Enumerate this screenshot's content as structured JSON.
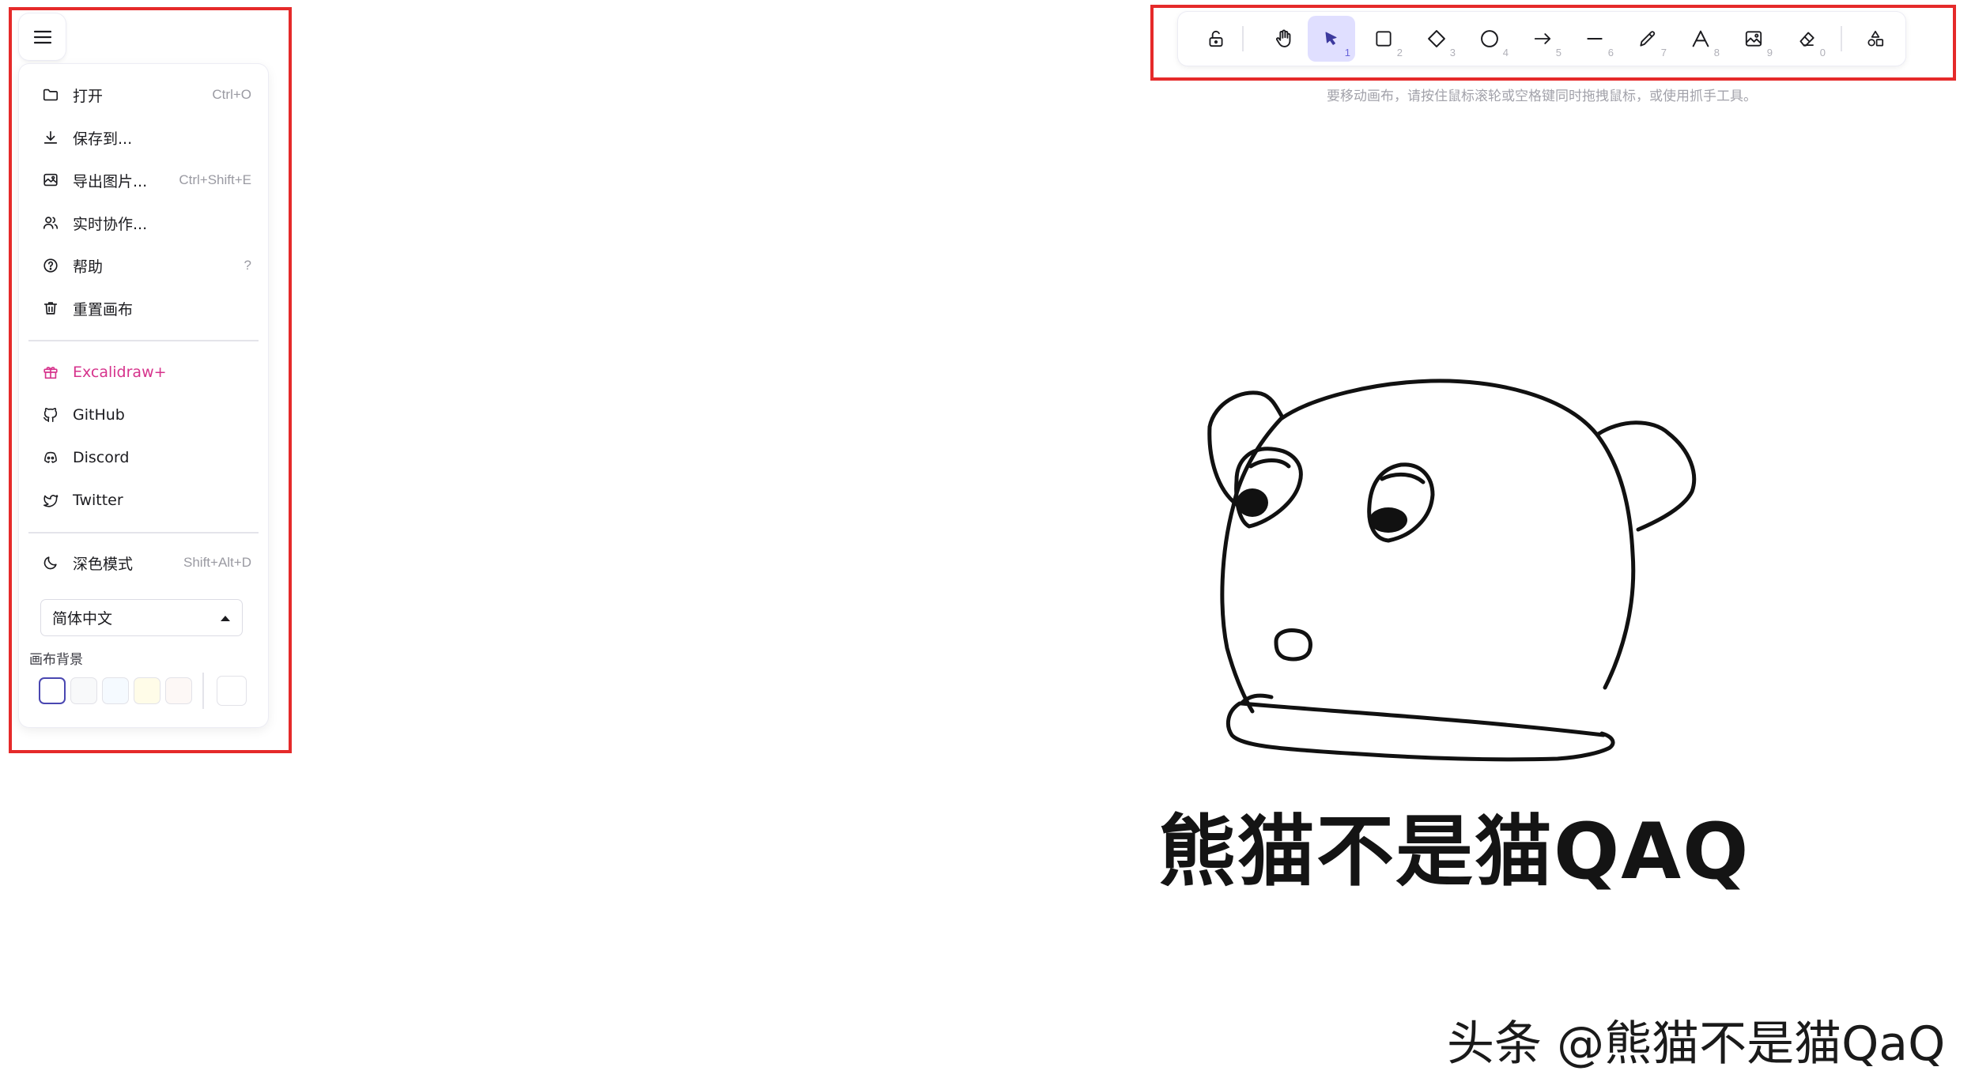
{
  "menu": {
    "items_main": [
      {
        "icon": "folder-icon",
        "label": "打开",
        "shortcut": "Ctrl+O"
      },
      {
        "icon": "download-icon",
        "label": "保存到...",
        "shortcut": ""
      },
      {
        "icon": "export-image-icon",
        "label": "导出图片...",
        "shortcut": "Ctrl+Shift+E"
      },
      {
        "icon": "users-icon",
        "label": "实时协作...",
        "shortcut": ""
      },
      {
        "icon": "help-icon",
        "label": "帮助",
        "shortcut": "?"
      },
      {
        "icon": "trash-icon",
        "label": "重置画布",
        "shortcut": ""
      }
    ],
    "items_links": [
      {
        "icon": "gift-icon",
        "label": "Excalidraw+"
      },
      {
        "icon": "github-icon",
        "label": "GitHub"
      },
      {
        "icon": "discord-icon",
        "label": "Discord"
      },
      {
        "icon": "twitter-icon",
        "label": "Twitter"
      }
    ],
    "dark_mode": {
      "icon": "moon-icon",
      "label": "深色模式",
      "shortcut": "Shift+Alt+D"
    },
    "language": {
      "selected": "简体中文"
    },
    "canvas_background": {
      "label": "画布背景",
      "colors": [
        "#ffffff",
        "#f8f9fa",
        "#f5faff",
        "#fffce8",
        "#fdf8f6"
      ],
      "custom": "#ffffff"
    }
  },
  "toolbar": {
    "tools": [
      {
        "name": "lock",
        "icon": "unlock-icon",
        "key": ""
      },
      {
        "name": "hand",
        "icon": "hand-icon",
        "key": ""
      },
      {
        "name": "selection",
        "icon": "pointer-icon",
        "key": "1",
        "active": true
      },
      {
        "name": "rectangle",
        "icon": "rectangle-icon",
        "key": "2"
      },
      {
        "name": "diamond",
        "icon": "diamond-icon",
        "key": "3"
      },
      {
        "name": "ellipse",
        "icon": "ellipse-icon",
        "key": "4"
      },
      {
        "name": "arrow",
        "icon": "arrow-icon",
        "key": "5"
      },
      {
        "name": "line",
        "icon": "line-icon",
        "key": "6"
      },
      {
        "name": "draw",
        "icon": "pencil-icon",
        "key": "7"
      },
      {
        "name": "text",
        "icon": "text-icon",
        "key": "8"
      },
      {
        "name": "image",
        "icon": "image-icon",
        "key": "9"
      },
      {
        "name": "eraser",
        "icon": "eraser-icon",
        "key": "0"
      },
      {
        "name": "library",
        "icon": "shapes-icon",
        "key": ""
      }
    ],
    "accent_color": "#6965db"
  },
  "canvas": {
    "hint": "要移动画布，请按住鼠标滚轮或空格键同时拖拽鼠标，或使用抓手工具。",
    "caption": "熊猫不是猫QAQ"
  },
  "watermark": "头条 @熊猫不是猫QaQ",
  "highlight_color": "#e52a2a"
}
